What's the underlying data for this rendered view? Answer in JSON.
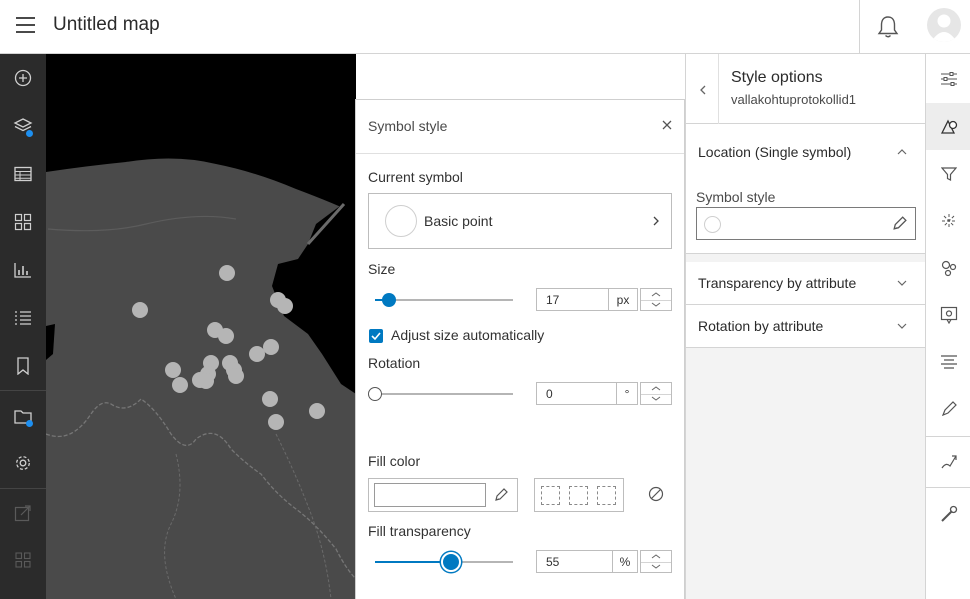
{
  "header": {
    "title": "Untitled map",
    "icons": [
      "hamburger-menu-icon",
      "notification-bell-icon",
      "user-avatar-icon"
    ]
  },
  "left_toolbar": {
    "icons": [
      "add-icon",
      "layers-icon",
      "table-icon",
      "legend-icon",
      "charts-icon",
      "sketch-list-icon",
      "bookmark-icon",
      "basemap-icon",
      "settings-icon",
      "share-icon",
      "apps-icon"
    ]
  },
  "map": {
    "background": "#454545",
    "land_color": "#4a4a4a",
    "water_color": "#000000",
    "point_color": "#bdbdbd"
  },
  "symbol_style": {
    "title": "Symbol style",
    "current_symbol_label": "Current symbol",
    "current_symbol_name": "Basic point",
    "size_label": "Size",
    "size_value": "17",
    "size_unit": "px",
    "size_slider_fraction": 0.1,
    "adjust_size_label": "Adjust size automatically",
    "adjust_size_checked": true,
    "rotation_label": "Rotation",
    "rotation_value": "0",
    "rotation_unit": "°",
    "rotation_slider_fraction": 0,
    "fill_color_label": "Fill color",
    "fill_transparency_label": "Fill transparency",
    "fill_transparency_value": "55",
    "fill_transparency_unit": "%",
    "fill_transparency_slider_fraction": 0.55,
    "accent": "#0079c1"
  },
  "style_options": {
    "title": "Style options",
    "layer_name": "vallakohtuprotokollid1",
    "location_section": "Location (Single symbol)",
    "symbol_style_label": "Symbol style",
    "transparency_section": "Transparency by attribute",
    "rotation_section": "Rotation by attribute"
  },
  "right_toolbar": {
    "icons": [
      "properties-icon",
      "styles-icon",
      "filter-icon",
      "effects-icon",
      "clustering-icon",
      "popups-icon",
      "labels-icon",
      "configure-fields-icon",
      "sketch-icon",
      "measurement-icon"
    ],
    "selected": "styles-icon"
  }
}
